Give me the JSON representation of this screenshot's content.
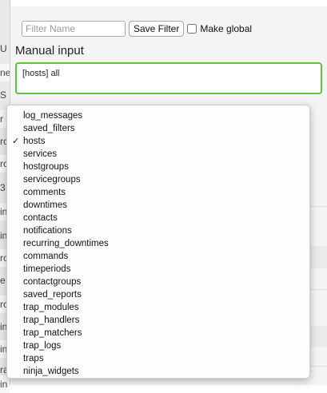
{
  "filter": {
    "name_placeholder": "Filter Name",
    "save_label": "Save Filter",
    "global_label": "Make global"
  },
  "manual": {
    "title": "Manual input",
    "query": "[hosts] all"
  },
  "dropdown": {
    "selected": "hosts",
    "check_glyph": "✓",
    "options": [
      "log_messages",
      "saved_filters",
      "hosts",
      "services",
      "hostgroups",
      "servicegroups",
      "comments",
      "downtimes",
      "contacts",
      "notifications",
      "recurring_downtimes",
      "commands",
      "timeperiods",
      "contactgroups",
      "saved_reports",
      "trap_modules",
      "trap_handlers",
      "trap_matchers",
      "trap_logs",
      "traps",
      "ninja_widgets"
    ]
  },
  "background": {
    "fragments": [
      "U",
      "ne",
      "S",
      "r i",
      "ro",
      "ro",
      "3",
      "in",
      "in",
      "ro",
      "e",
      "ro",
      "in",
      "in",
      "ra",
      "in"
    ]
  },
  "icons": {
    "select_arrow": "up-down-chevron-icon"
  }
}
